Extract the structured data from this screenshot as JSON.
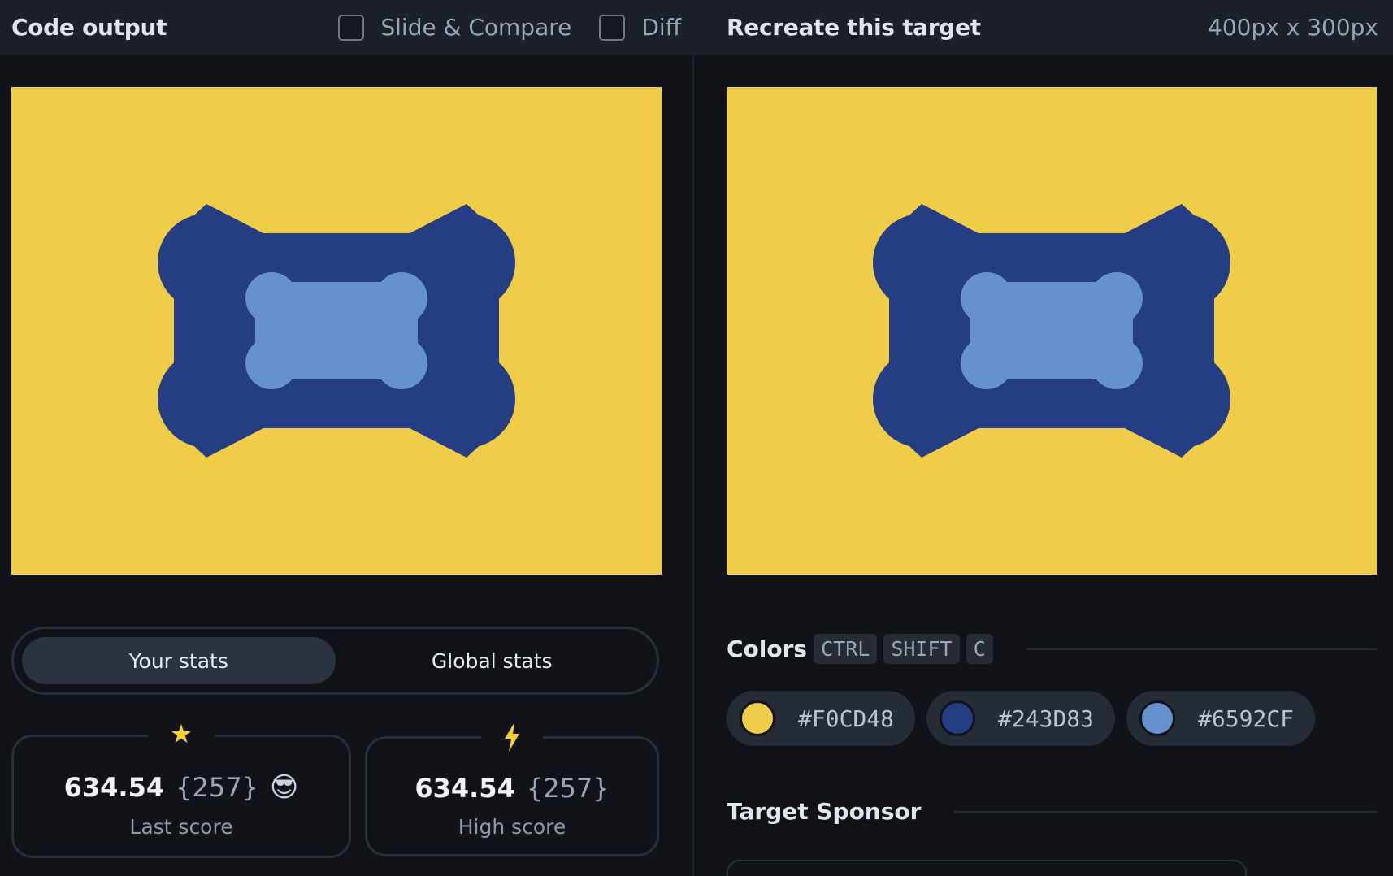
{
  "left_bar": {
    "title": "Code output",
    "slide_compare_label": "Slide & Compare",
    "diff_label": "Diff"
  },
  "right_bar": {
    "title": "Recreate this target",
    "dimensions": "400px x 300px"
  },
  "canvas_colors": {
    "background": "#F0CD48",
    "outer_shape": "#243D83",
    "inner_shape": "#6592CF"
  },
  "stats": {
    "tabs": [
      {
        "label": "Your stats",
        "active": true
      },
      {
        "label": "Global stats",
        "active": false
      }
    ],
    "last_score": {
      "value": "634.54",
      "count": "{257}",
      "emoji": "😎",
      "label": "Last score",
      "icon": "star-icon"
    },
    "high_score": {
      "value": "634.54",
      "count": "{257}",
      "label": "High score",
      "icon": "lightning-icon"
    }
  },
  "colors_section": {
    "title": "Colors",
    "shortcut": [
      "CTRL",
      "SHIFT",
      "C"
    ],
    "swatches": [
      {
        "hex": "#F0CD48"
      },
      {
        "hex": "#243D83"
      },
      {
        "hex": "#6592CF"
      }
    ]
  },
  "sponsor_section": {
    "title": "Target Sponsor"
  }
}
